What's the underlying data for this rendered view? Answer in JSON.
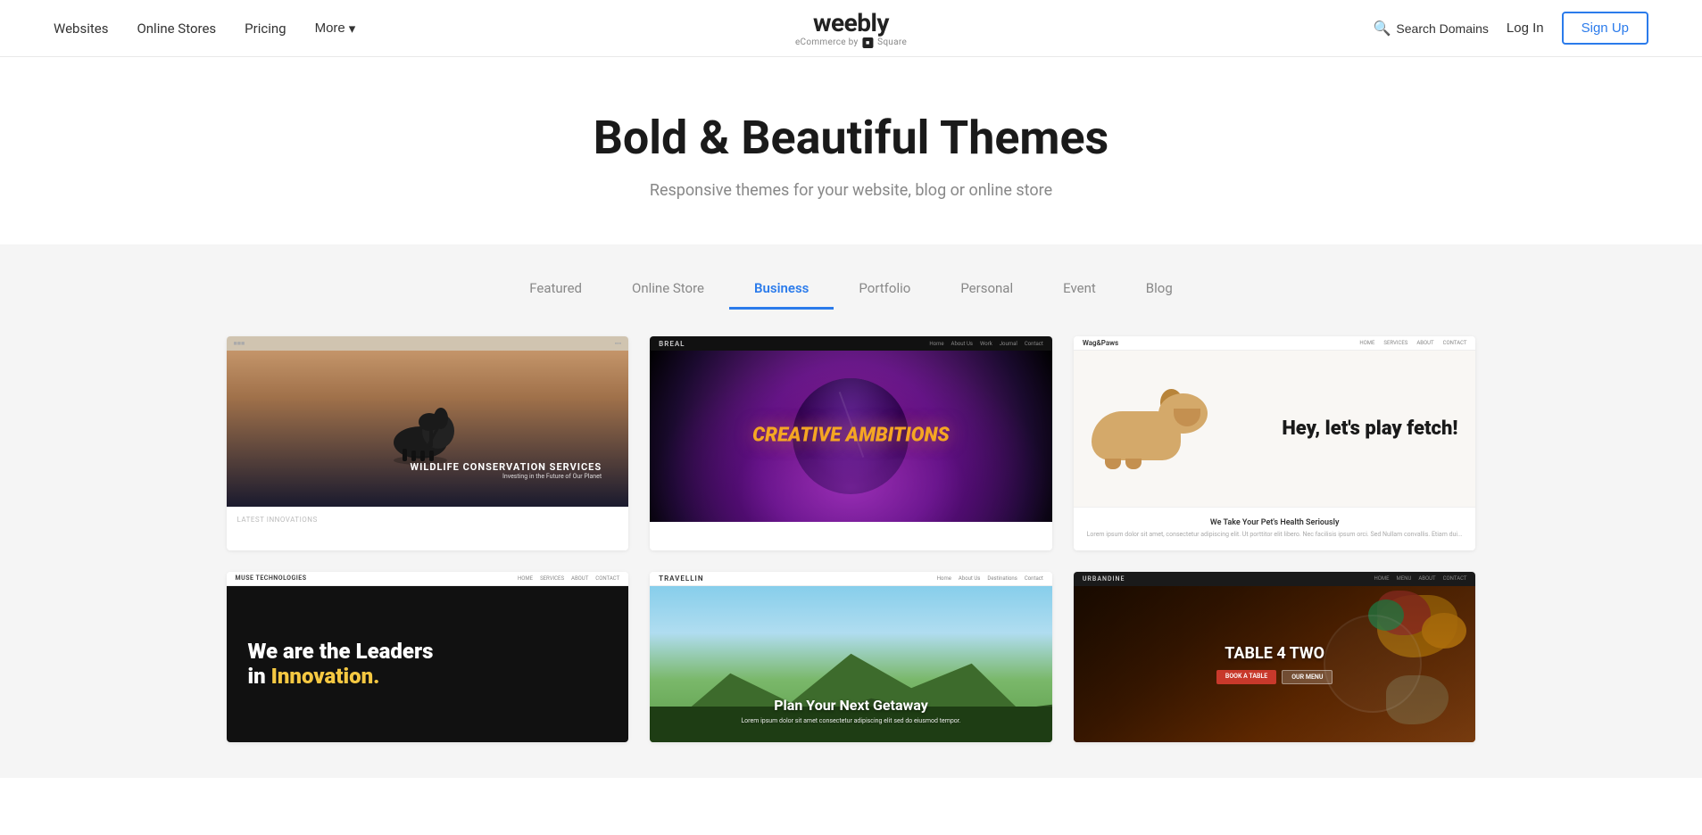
{
  "header": {
    "nav_items": [
      "Websites",
      "Online Stores",
      "Pricing",
      "More"
    ],
    "logo_main": "weebly",
    "logo_sub": "eCommerce by",
    "logo_sub2": "Square",
    "search_label": "Search Domains",
    "login_label": "Log In",
    "signup_label": "Sign Up"
  },
  "hero": {
    "title": "Bold & Beautiful Themes",
    "subtitle": "Responsive themes for your website, blog or online store"
  },
  "tabs": {
    "items": [
      "Featured",
      "Online Store",
      "Business",
      "Portfolio",
      "Personal",
      "Event",
      "Blog"
    ],
    "active": "Business"
  },
  "themes": {
    "row1": [
      {
        "id": "wildlife",
        "name": "Wildlife Conservation",
        "brand": "",
        "headline": "WILDLIFE CONSERVATION SERVICES",
        "subline": "Investing in the Future of Our Planet",
        "footer_text": "Latest Innovations"
      },
      {
        "id": "breal",
        "name": "Breal",
        "brand": "BREAL",
        "nav": [
          "Home",
          "About Us",
          "Work",
          "Journal",
          "Contact"
        ],
        "headline": "CREATIVE AMBITIONS",
        "subline": ""
      },
      {
        "id": "wagpaws",
        "name": "Wag & Paws",
        "brand": "Wag&Paws",
        "nav": [
          "HOME",
          "SERVICES",
          "ABOUT",
          "CONTACT"
        ],
        "headline": "Hey, let's play fetch!",
        "footer_title": "We Take Your Pet's Health Seriously",
        "footer_text": "Lorem ipsum dolor sit amet, consectetur adipiscing elit. Ut porttitor elit libero. Nec facilisis ipsum orci. Sed Nullam convallis. Etiam dui..."
      }
    ],
    "row2": [
      {
        "id": "muse",
        "name": "Muse Technologies",
        "brand": "MUSE TECHNOLOGIES",
        "nav": [
          "HOME",
          "SERVICES",
          "ABOUT",
          "CONTACT"
        ],
        "headline": "We are the Leaders in Innovation.",
        "headline_accent": ""
      },
      {
        "id": "travellin",
        "name": "Travellin",
        "brand": "TRAVELLIN",
        "nav": [
          "Home",
          "About Us",
          "Destinations",
          "Contact"
        ],
        "headline": "Plan Your Next Getaway",
        "subline": "Lorem ipsum dolor sit amet consectetur adipiscing elit sed do eiusmod tempor."
      },
      {
        "id": "urbandine",
        "name": "Urbandine",
        "brand": "URBANDINE",
        "nav": [
          "",
          "",
          "",
          ""
        ],
        "headline": "TABLE 4 TWO",
        "btn1": "BOOK A TABLE",
        "btn2": "OUR MENU"
      }
    ]
  }
}
